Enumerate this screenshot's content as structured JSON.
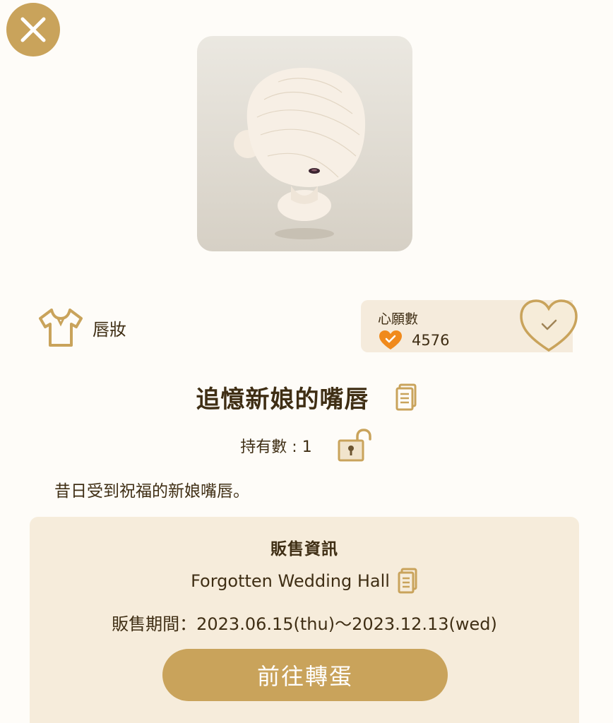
{
  "header": {
    "close_icon": "close-icon"
  },
  "item": {
    "category_label": "唇妝",
    "category_icon": "shirt-icon",
    "name": "追憶新娘的嘴唇",
    "owned_text": "持有數 : 1",
    "description": "昔日受到祝福的新娘嘴唇。",
    "copy_icon": "document-icon",
    "lock_icon": "unlocked-padlock-icon"
  },
  "wishlist": {
    "label": "心願數",
    "count": "4576",
    "heart_icon": "heart-check-icon",
    "toggle_icon": "heart-outline-check-icon"
  },
  "sale": {
    "heading": "販售資訊",
    "source": "Forgotten Wedding Hall",
    "period": "販售期間：2023.06.15(thu)～2023.12.13(wed)",
    "button_label": "前往轉蛋"
  },
  "colors": {
    "accent": "#c9a35b",
    "text": "#3f2e14",
    "panel": "#f6ecdb",
    "wish_heart": "#f08a1c",
    "background": "#fefcf8"
  }
}
